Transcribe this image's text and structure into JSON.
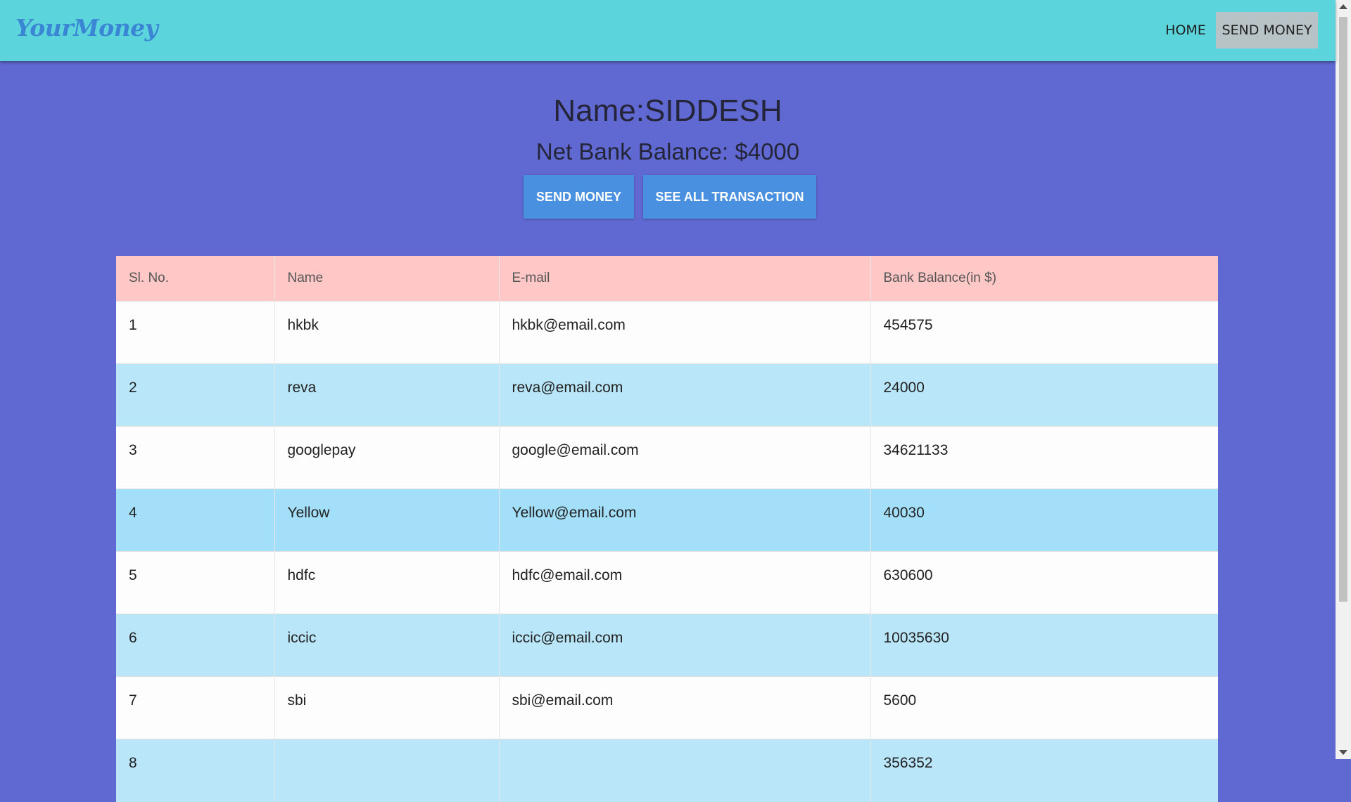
{
  "navbar": {
    "brand": "YourMoney",
    "links": [
      {
        "label": "HOME"
      },
      {
        "label": "SEND MONEY"
      }
    ]
  },
  "profile": {
    "name_line": "Name:SIDDESH",
    "balance_line": "Net Bank Balance: $4000"
  },
  "actions": {
    "send_money": "SEND MONEY",
    "see_all": "SEE ALL TRANSACTION"
  },
  "table": {
    "headers": [
      "Sl. No.",
      "Name",
      "E-mail",
      "Bank Balance(in $)"
    ],
    "rows": [
      [
        "1",
        "hkbk",
        "hkbk@email.com",
        "454575"
      ],
      [
        "2",
        "reva",
        "reva@email.com",
        "24000"
      ],
      [
        "3",
        "googlepay",
        "google@email.com",
        "34621133"
      ],
      [
        "4",
        "Yellow",
        "Yellow@email.com",
        "40030"
      ],
      [
        "5",
        "hdfc",
        "hdfc@email.com",
        "630600"
      ],
      [
        "6",
        "iccic",
        "iccic@email.com",
        "10035630"
      ],
      [
        "7",
        "sbi",
        "sbi@email.com",
        "5600"
      ],
      [
        "8",
        "",
        "",
        "356352"
      ]
    ]
  },
  "colors": {
    "navbar_bg": "#5bd5db",
    "page_bg": "#6068d1",
    "button_bg": "#4a90e0",
    "table_header_bg": "#ffc8c6",
    "row_alt_bg": "#b9e6f8"
  }
}
